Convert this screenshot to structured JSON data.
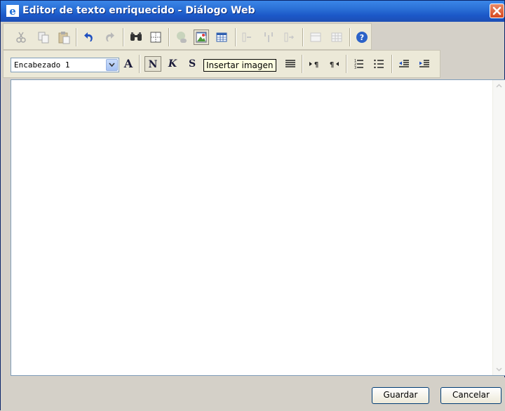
{
  "window": {
    "title": "Editor de texto enriquecido - Diálogo Web",
    "close_icon": "close-icon"
  },
  "toolbar1": {
    "buttons": [
      "cut-icon",
      "copy-icon",
      "paste-icon",
      "undo-icon",
      "redo-icon",
      "find-icon",
      "select-all-icon",
      "insert-link-icon",
      "insert-image-icon",
      "insert-table-icon",
      "insert-row-icon",
      "insert-column-icon",
      "insert-cell-icon",
      "table-properties-icon",
      "cell-properties-icon",
      "help-icon"
    ]
  },
  "toolbar2": {
    "heading_select": {
      "value": "Encabezado 1"
    },
    "font_glyph": "A",
    "bold_glyph": "N",
    "italic_glyph": "K",
    "underline_glyph": "S"
  },
  "tooltip": {
    "text": "Insertar imagen"
  },
  "buttons": {
    "save_label": "Guardar",
    "cancel_label": "Cancelar"
  },
  "colors": {
    "titlebar": "#2a6fd6",
    "toolbar_bg": "#ece9d8",
    "dialog_bg": "#d4d0c8",
    "close_button": "#d8481e"
  }
}
